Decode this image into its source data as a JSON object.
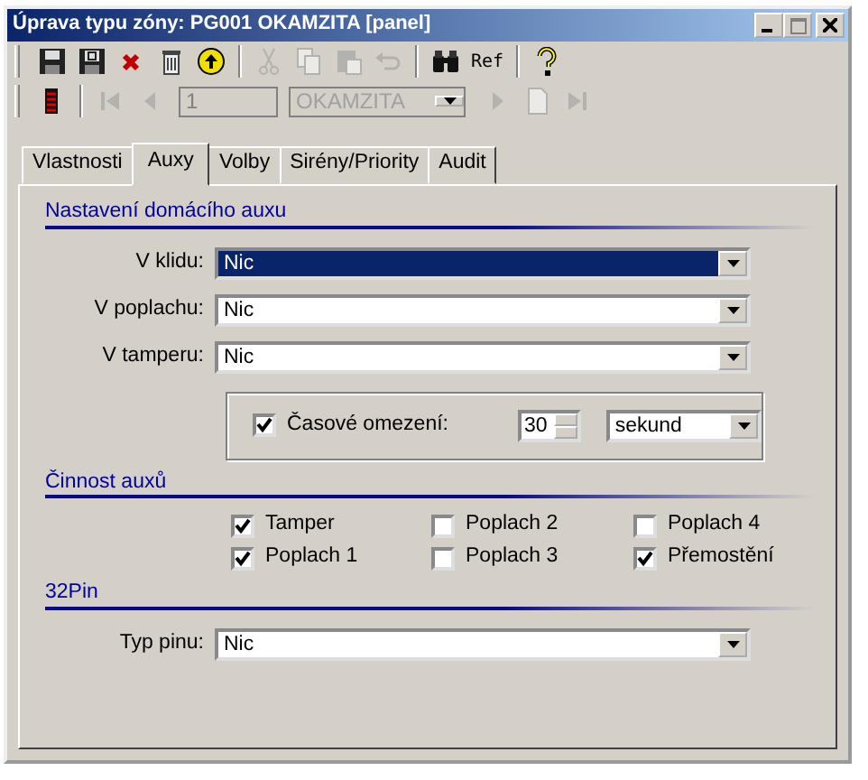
{
  "window": {
    "title": "Úprava typu zóny: PG001 OKAMZITA [panel]"
  },
  "toolbar_1": [
    {
      "kind": "save",
      "disabled": false
    },
    {
      "kind": "save-as",
      "disabled": false
    },
    {
      "kind": "delete",
      "disabled": false
    },
    {
      "kind": "trash",
      "disabled": false
    },
    {
      "kind": "up",
      "disabled": false
    },
    {
      "kind": "sep"
    },
    {
      "kind": "cut",
      "disabled": true
    },
    {
      "kind": "copy",
      "disabled": true
    },
    {
      "kind": "paste",
      "disabled": true
    },
    {
      "kind": "undo",
      "disabled": true
    },
    {
      "kind": "sep"
    },
    {
      "kind": "find",
      "disabled": false
    },
    {
      "kind": "ref",
      "label": "Ref",
      "disabled": false
    },
    {
      "kind": "sep"
    },
    {
      "kind": "help",
      "disabled": false
    }
  ],
  "toolbar_2": [
    {
      "kind": "list",
      "disabled": false
    },
    {
      "kind": "sep"
    },
    {
      "kind": "first",
      "disabled": true
    },
    {
      "kind": "prev",
      "disabled": true
    },
    {
      "kind": "field",
      "value": "1",
      "disabled": true
    },
    {
      "kind": "combo",
      "value": "OKAMZITA",
      "disabled": true
    },
    {
      "kind": "next",
      "disabled": true
    },
    {
      "kind": "new",
      "disabled": true
    },
    {
      "kind": "last",
      "disabled": true
    }
  ],
  "tabs": [
    {
      "label": "Vlastnosti",
      "selected": false
    },
    {
      "label": "Auxy",
      "selected": true
    },
    {
      "label": "Volby",
      "selected": false
    },
    {
      "label": "Sirény/Priority",
      "selected": false
    },
    {
      "label": "Audit",
      "selected": false
    }
  ],
  "home_aux": {
    "heading": "Nastavení domácího auxu",
    "fields": [
      {
        "label": "V klidu:",
        "value": "Nic",
        "focused": true
      },
      {
        "label": "V poplachu:",
        "value": "Nic",
        "focused": false
      },
      {
        "label": "V tamperu:",
        "value": "Nic",
        "focused": false
      }
    ],
    "time_limit": {
      "label": "Časové omezení:",
      "checked": true,
      "value": "30",
      "unit": "sekund"
    }
  },
  "aux_activity": {
    "heading": "Činnost auxů",
    "options": [
      {
        "label": "Tamper",
        "checked": true
      },
      {
        "label": "Poplach 2",
        "checked": false
      },
      {
        "label": "Poplach 4",
        "checked": false
      },
      {
        "label": "Poplach 1",
        "checked": true
      },
      {
        "label": "Poplach 3",
        "checked": false
      },
      {
        "label": "Přemostění",
        "checked": true
      }
    ]
  },
  "pin": {
    "heading": "32Pin",
    "field": {
      "label": "Typ pinu:",
      "value": "Nic"
    }
  }
}
